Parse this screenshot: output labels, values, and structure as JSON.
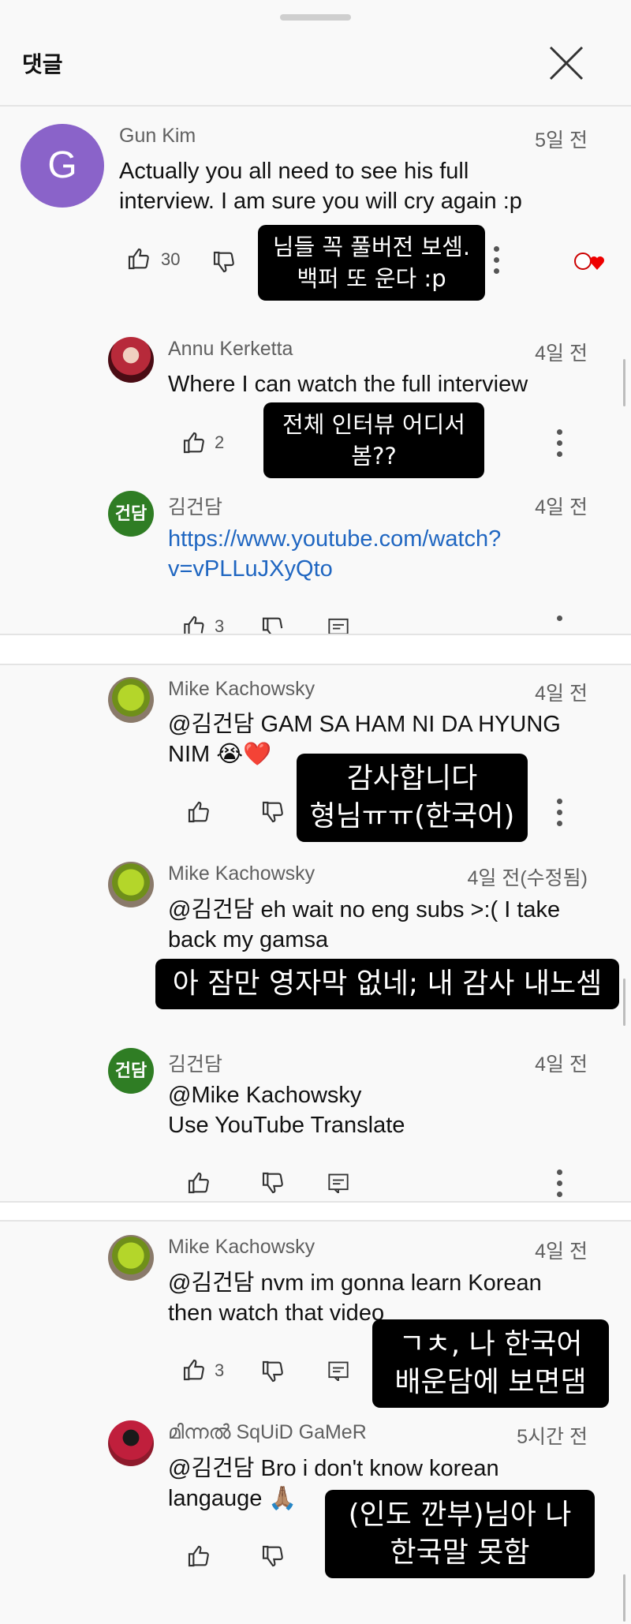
{
  "header": {
    "title": "댓글",
    "close_icon": "close-icon"
  },
  "thread1": {
    "top": {
      "avatar_letter": "G",
      "author": "Gun Kim",
      "time": "5일 전",
      "text": "Actually you all need to see his full\ninterview. I am sure you will cry again :p",
      "likes": "30"
    },
    "replies": [
      {
        "author": "Annu Kerketta",
        "time": "4일 전",
        "text": "Where I can watch the full interview",
        "likes": "2"
      },
      {
        "avatar_text": "건담",
        "author": "김건담",
        "time": "4일 전",
        "text": "https://www.youtube.com/watch?\nv=vPLLuJXyQto",
        "likes": "3"
      }
    ]
  },
  "thread2": {
    "replies": [
      {
        "author": "Mike Kachowsky",
        "time": "4일 전",
        "text": " @김건담  GAM SA HAM NI DA HYUNG\nNIM 😭❤️"
      },
      {
        "author": "Mike Kachowsky",
        "time": "4일 전(수정됨)",
        "text": " @김건담  eh wait no eng subs >:( I take\nback my gamsa"
      },
      {
        "avatar_text": "건담",
        "author": "김건담",
        "time": "4일 전",
        "text": " @Mike Kachowsky\nUse YouTube Translate"
      }
    ]
  },
  "thread3": {
    "replies": [
      {
        "author": "Mike Kachowsky",
        "time": "4일 전",
        "text": " @김건담  nvm im gonna learn Korean\nthen watch that video",
        "likes": "3"
      },
      {
        "author": "മിന്നൽ SqUiD GaMeR",
        "time": "5시간 전",
        "text": " @김건담  Bro i don't know korean\nlangauge 🙏🏽"
      }
    ]
  },
  "captions": {
    "c1": "님들 꼭 풀버전 보셈.\n백퍼 또 운다 :p",
    "c2": "전체 인터뷰 어디서\n봄??",
    "c3": "감사합니다\n형님ㅠㅠ(한국어)",
    "c4": "아 잠만 영자막 없네; 내 감사 내노셈",
    "c5": "ㄱㅊ, 나 한국어\n배운담에 보면댐",
    "c6": "(인도 깐부)님아 나\n한국말 못함"
  },
  "colors": {
    "link": "#1f66c1",
    "caption_bg": "#000000",
    "accent_avatar_g": "#8a63c9",
    "avatar_gundam": "#2f7d24"
  }
}
